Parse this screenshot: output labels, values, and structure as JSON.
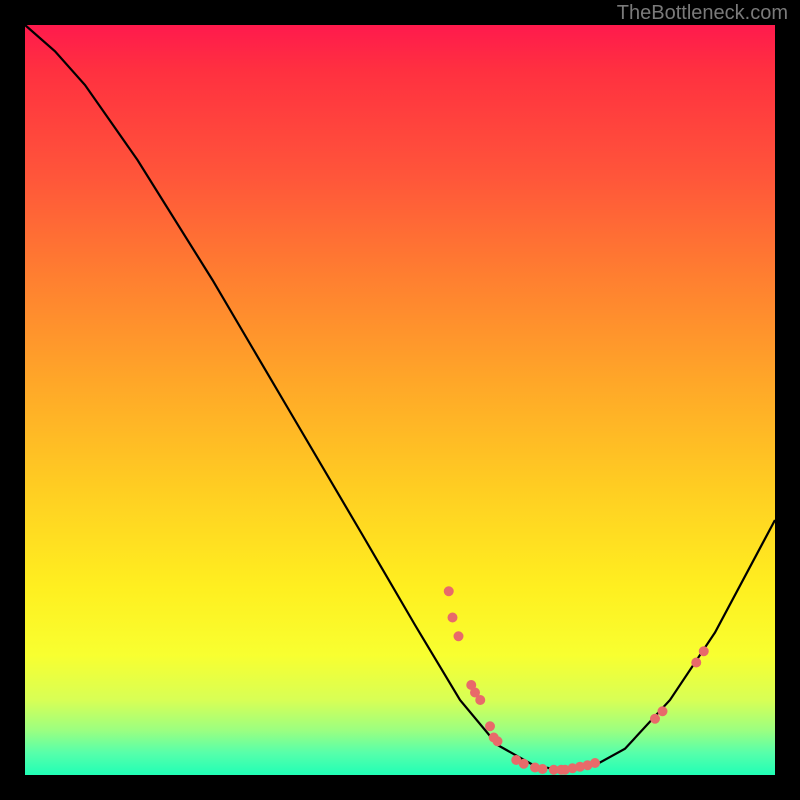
{
  "watermark": "TheBottleneck.com",
  "chart_data": {
    "type": "line",
    "title": "",
    "xlabel": "",
    "ylabel": "",
    "xlim": [
      0,
      100
    ],
    "ylim": [
      0,
      100
    ],
    "curve": [
      {
        "x": 0.0,
        "y": 100.0
      },
      {
        "x": 4.0,
        "y": 96.5
      },
      {
        "x": 8.0,
        "y": 92.0
      },
      {
        "x": 15.0,
        "y": 82.0
      },
      {
        "x": 25.0,
        "y": 66.0
      },
      {
        "x": 35.0,
        "y": 49.0
      },
      {
        "x": 45.0,
        "y": 32.0
      },
      {
        "x": 52.0,
        "y": 20.0
      },
      {
        "x": 58.0,
        "y": 10.0
      },
      {
        "x": 63.0,
        "y": 4.0
      },
      {
        "x": 68.0,
        "y": 1.2
      },
      {
        "x": 72.0,
        "y": 0.6
      },
      {
        "x": 76.0,
        "y": 1.3
      },
      {
        "x": 80.0,
        "y": 3.5
      },
      {
        "x": 86.0,
        "y": 10.0
      },
      {
        "x": 92.0,
        "y": 19.0
      },
      {
        "x": 100.0,
        "y": 34.0
      }
    ],
    "markers": [
      {
        "x": 56.5,
        "y": 24.5
      },
      {
        "x": 57.0,
        "y": 21.0
      },
      {
        "x": 57.8,
        "y": 18.5
      },
      {
        "x": 59.5,
        "y": 12.0
      },
      {
        "x": 60.0,
        "y": 11.0
      },
      {
        "x": 60.7,
        "y": 10.0
      },
      {
        "x": 62.0,
        "y": 6.5
      },
      {
        "x": 62.5,
        "y": 5.0
      },
      {
        "x": 63.0,
        "y": 4.5
      },
      {
        "x": 65.5,
        "y": 2.0
      },
      {
        "x": 66.5,
        "y": 1.5
      },
      {
        "x": 68.0,
        "y": 1.0
      },
      {
        "x": 69.0,
        "y": 0.8
      },
      {
        "x": 70.5,
        "y": 0.7
      },
      {
        "x": 71.5,
        "y": 0.7
      },
      {
        "x": 72.0,
        "y": 0.7
      },
      {
        "x": 73.0,
        "y": 0.9
      },
      {
        "x": 74.0,
        "y": 1.1
      },
      {
        "x": 75.0,
        "y": 1.3
      },
      {
        "x": 76.0,
        "y": 1.6
      },
      {
        "x": 84.0,
        "y": 7.5
      },
      {
        "x": 85.0,
        "y": 8.5
      },
      {
        "x": 89.5,
        "y": 15.0
      },
      {
        "x": 90.5,
        "y": 16.5
      }
    ],
    "marker_color": "#e86a6a",
    "curve_color": "#000000"
  }
}
